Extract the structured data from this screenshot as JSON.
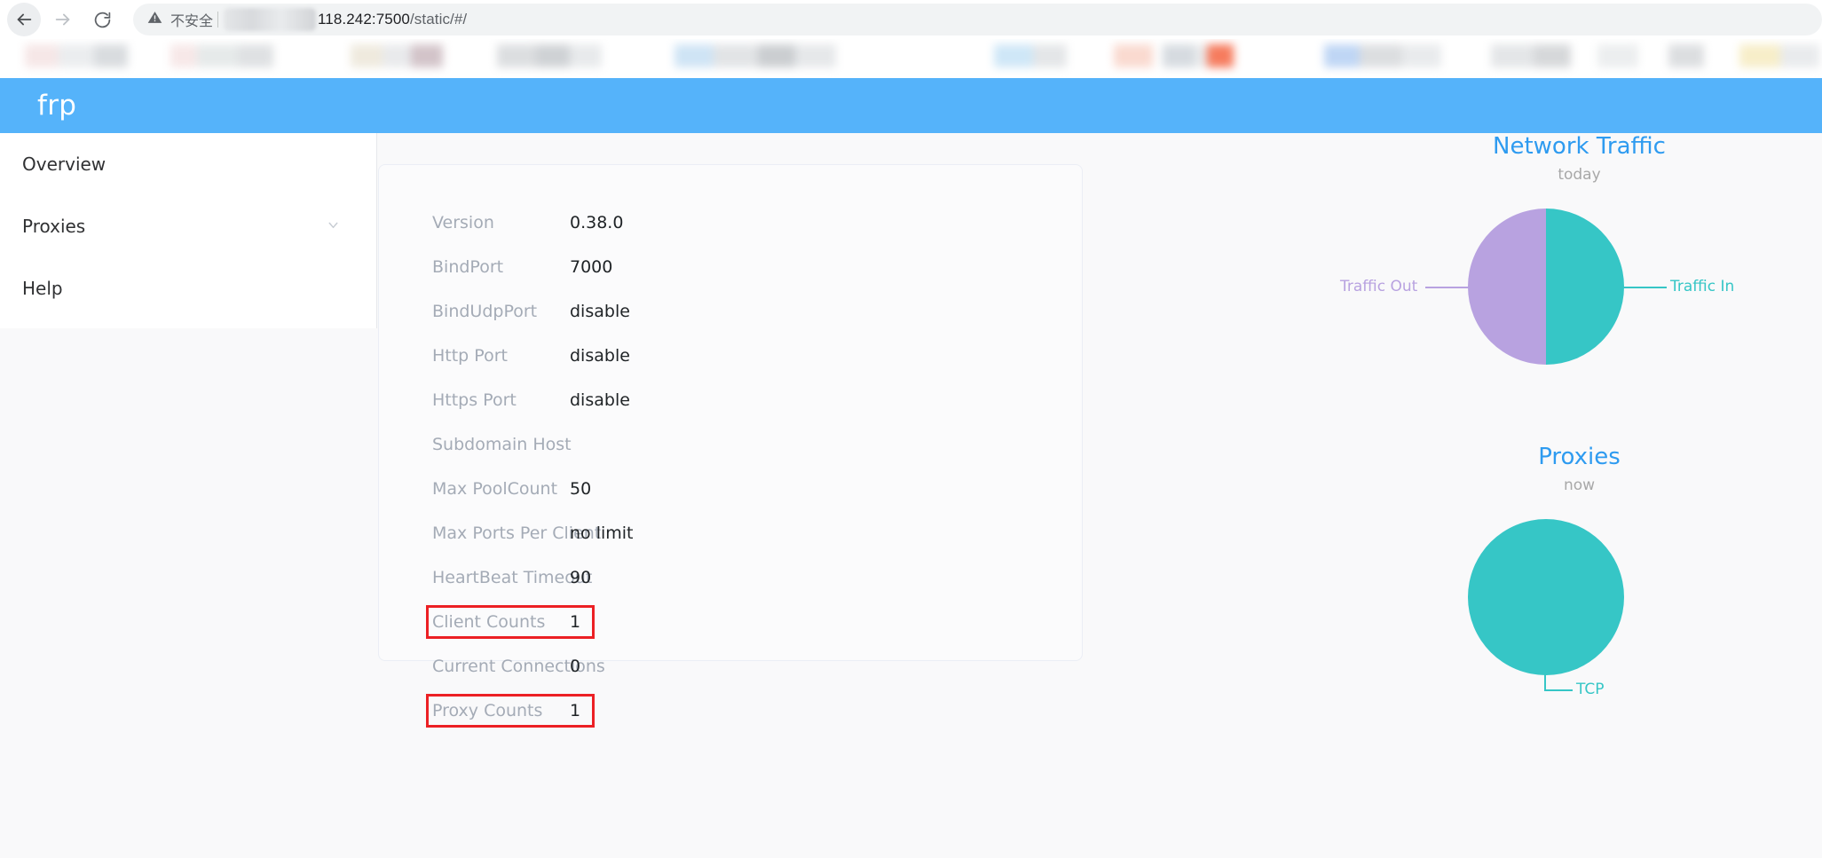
{
  "browser": {
    "back_icon": "arrow-left-icon",
    "forward_icon": "arrow-right-icon",
    "reload_icon": "reload-icon",
    "warning_icon": "warning-triangle-icon",
    "insecure_label": "不安全",
    "url_host_suffix": "118.242",
    "url_port": ":7500",
    "url_path": "/static/#/"
  },
  "app": {
    "title": "frp",
    "header_color": "#55b3fa"
  },
  "sidebar": {
    "items": [
      {
        "label": "Overview",
        "has_chevron": false
      },
      {
        "label": "Proxies",
        "has_chevron": true
      },
      {
        "label": "Help",
        "has_chevron": false
      }
    ],
    "chevron_icon": "chevron-down-icon"
  },
  "info": {
    "rows": [
      {
        "label": "Version",
        "value": "0.38.0",
        "highlighted": false
      },
      {
        "label": "BindPort",
        "value": "7000",
        "highlighted": false
      },
      {
        "label": "BindUdpPort",
        "value": "disable",
        "highlighted": false
      },
      {
        "label": "Http Port",
        "value": "disable",
        "highlighted": false
      },
      {
        "label": "Https Port",
        "value": "disable",
        "highlighted": false
      },
      {
        "label": "Subdomain Host",
        "value": "",
        "highlighted": false
      },
      {
        "label": "Max PoolCount",
        "value": "50",
        "highlighted": false
      },
      {
        "label": "Max Ports Per Client",
        "value": "no limit",
        "highlighted": false
      },
      {
        "label": "HeartBeat Timeout",
        "value": "90",
        "highlighted": false
      },
      {
        "label": "Client Counts",
        "value": "1",
        "highlighted": true
      },
      {
        "label": "Current Connections",
        "value": "0",
        "highlighted": false
      },
      {
        "label": "Proxy Counts",
        "value": "1",
        "highlighted": true
      }
    ],
    "highlight_color": "#ec2024"
  },
  "chart_data": [
    {
      "type": "pie",
      "title": "Network Traffic",
      "subtitle": "today",
      "categories": [
        "Traffic Out",
        "Traffic In"
      ],
      "values": [
        50,
        50
      ],
      "colors": [
        "#b8a2e0",
        "#36c6c6"
      ],
      "legend": "leader-lines",
      "label_left": "Traffic Out",
      "label_right": "Traffic In"
    },
    {
      "type": "pie",
      "title": "Proxies",
      "subtitle": "now",
      "categories": [
        "TCP"
      ],
      "values": [
        100
      ],
      "colors": [
        "#36c6c6"
      ],
      "legend": "leader-lines",
      "label_bottom": "TCP"
    }
  ]
}
